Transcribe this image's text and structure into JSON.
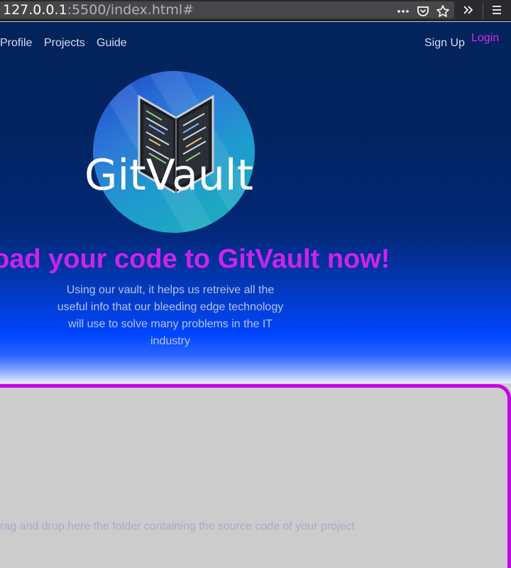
{
  "browser": {
    "url_host": "127.0.0.1",
    "url_path": ":5500/index.html#",
    "icons": [
      "more-horizontal-icon",
      "pocket-icon",
      "bookmark-star-icon",
      "overflow-chevron-icon",
      "hamburger-menu-icon"
    ]
  },
  "nav": {
    "profile": "Profile",
    "projects": "Projects",
    "guide": "Guide",
    "signup": "Sign Up",
    "login": "Login"
  },
  "hero": {
    "logo_text": "GitVault",
    "headline": "oad your code to GitVault now!",
    "tagline": "Using our vault, it helps us retreive all the useful info that our bleeding edge technology will use to solve many problems in the IT industry"
  },
  "dropzone": {
    "text": "rag and drop here the folder containing the source code of your project"
  },
  "colors": {
    "accent_magenta": "#cc22ee",
    "login_magenta": "#d22ee8",
    "dropzone_border": "#c400e6",
    "hero_top": "#03235c",
    "hero_mid": "#0045ff",
    "page_bg": "#cccccc"
  }
}
